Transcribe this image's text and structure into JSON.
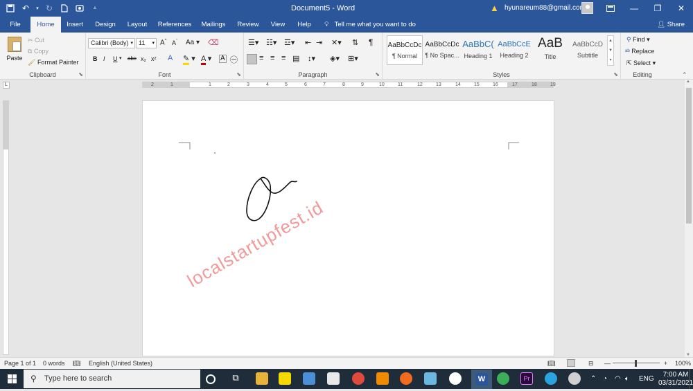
{
  "app": {
    "doc_title": "Document5  -  Word",
    "account_email": "hyunareum88@gmail.com"
  },
  "tabs": [
    "File",
    "Home",
    "Insert",
    "Design",
    "Layout",
    "References",
    "Mailings",
    "Review",
    "View",
    "Help"
  ],
  "tell_me": "Tell me what you want to do",
  "share": "Share",
  "clipboard": {
    "paste": "Paste",
    "cut": "Cut",
    "copy": "Copy",
    "format_painter": "Format Painter",
    "label": "Clipboard"
  },
  "font": {
    "name": "Calibri (Body)",
    "size": "11",
    "label": "Font",
    "grow": "A",
    "shrink": "A",
    "case": "Aa",
    "bold": "B",
    "italic": "I",
    "underline": "U",
    "strike": "abc",
    "sub": "x₂",
    "sup": "x²"
  },
  "paragraph": {
    "label": "Paragraph",
    "show_marks": "¶"
  },
  "styles": {
    "label": "Styles",
    "items": [
      {
        "preview": "AaBbCcDc",
        "name": "¶ Normal"
      },
      {
        "preview": "AaBbCcDc",
        "name": "¶ No Spac..."
      },
      {
        "preview": "AaBbC(",
        "name": "Heading 1"
      },
      {
        "preview": "AaBbCcE",
        "name": "Heading 2"
      },
      {
        "preview": "AaB",
        "name": "Title"
      },
      {
        "preview": "AaBbCcD",
        "name": "Subtitle"
      }
    ]
  },
  "editing": {
    "find": "Find",
    "replace": "Replace",
    "select": "Select",
    "label": "Editing"
  },
  "ruler_numbers": [
    "2",
    "1",
    "1",
    "2",
    "3",
    "4",
    "5",
    "6",
    "7",
    "8",
    "9",
    "10",
    "11",
    "12",
    "13",
    "14",
    "15",
    "16",
    "17",
    "18",
    "19"
  ],
  "status": {
    "page": "Page 1 of 1",
    "words": "0 words",
    "language": "English (United States)",
    "zoom": "100%"
  },
  "taskbar": {
    "search_placeholder": "Type here to search",
    "time": "7:00 AM",
    "date": "03/31/2021",
    "lang": "ENG"
  },
  "watermark": "localstartupfest.id",
  "colors": {
    "accent": "#2b579a",
    "highlight": "#ffd700",
    "font_color": "#c00000",
    "watermark": "#f19a9a"
  }
}
